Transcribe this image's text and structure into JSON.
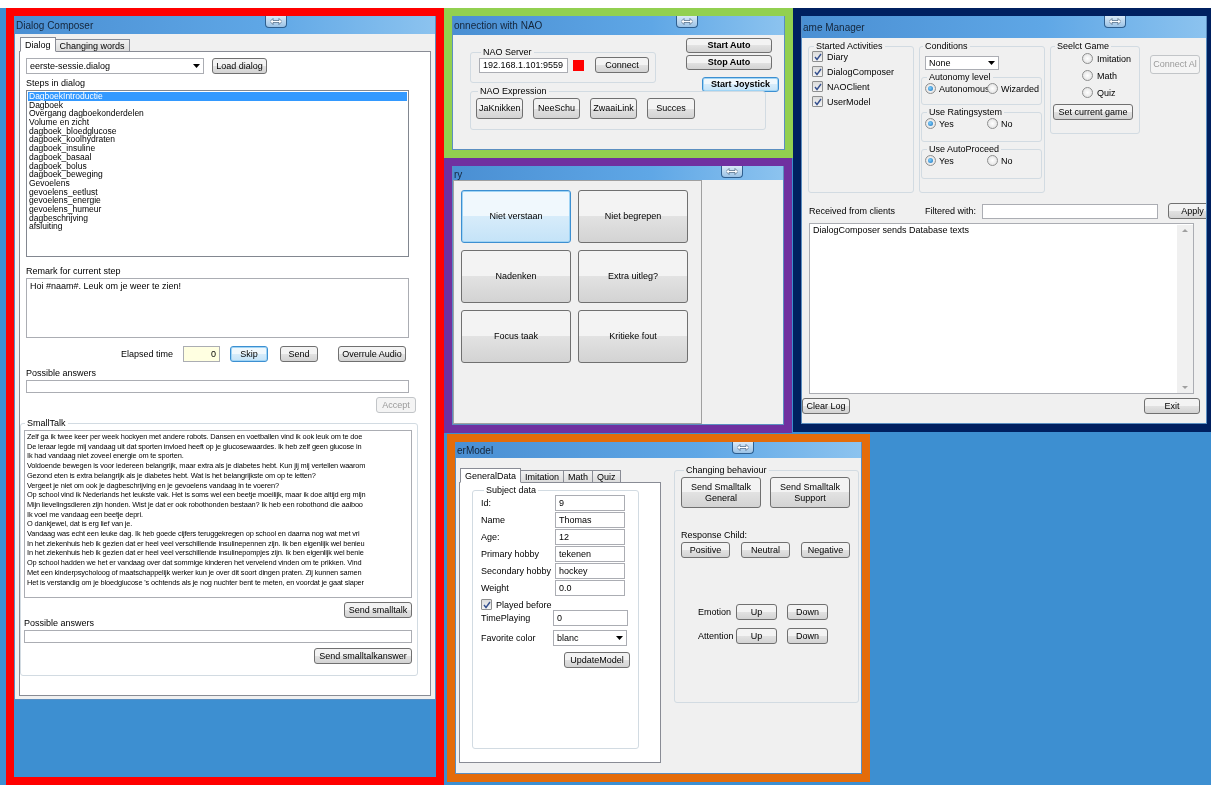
{
  "dialog_composer": {
    "title": "Dialog Composer",
    "tabs": [
      {
        "label": "Dialog",
        "selected": true
      },
      {
        "label": "Changing words",
        "selected": false
      }
    ],
    "dialog_file": "eerste-sessie.dialog",
    "load_button": "Load dialog",
    "steps_label": "Steps in dialog",
    "steps": [
      {
        "label": "DagboekIntroductie",
        "selected": true
      },
      {
        "label": "Dagboek",
        "selected": false
      },
      {
        "label": "Overgang dagboekonderdelen",
        "selected": false
      },
      {
        "label": "Volume en zicht",
        "selected": false
      },
      {
        "label": "dagboek_bloedglucose",
        "selected": false
      },
      {
        "label": "dagboek_koolhydraten",
        "selected": false
      },
      {
        "label": "dagboek_insuline",
        "selected": false
      },
      {
        "label": "dagboek_basaal",
        "selected": false
      },
      {
        "label": "dagboek_bolus",
        "selected": false
      },
      {
        "label": "dagboek_beweging",
        "selected": false
      },
      {
        "label": "Gevoelens",
        "selected": false
      },
      {
        "label": "gevoelens_eetlust",
        "selected": false
      },
      {
        "label": "gevoelens_energie",
        "selected": false
      },
      {
        "label": "gevoelens_humeur",
        "selected": false
      },
      {
        "label": "dagbeschrijving",
        "selected": false
      },
      {
        "label": "afsluiting",
        "selected": false
      }
    ],
    "remark_label": "Remark for current step",
    "remark": "Hoi #naam#. Leuk om je weer te zien!",
    "elapsed_label": "Elapsed time",
    "elapsed_value": "0",
    "controls": [
      {
        "label": "Skip",
        "focused": true
      },
      {
        "label": "Send",
        "focused": false
      },
      {
        "label": "Overrule Audio",
        "focused": false
      }
    ],
    "answers_label": "Possible answers",
    "accept": {
      "label": "Accept",
      "disabled": true
    },
    "smalltalk": {
      "title": "SmallTalk",
      "lines": [
        "Zelf ga ik twee keer per week hockyen met andere robots. Dansen en voetballen vind ik ook leuk om te doe",
        "De leraar legde mij vandaag uit dat sporten invloed heeft op je glucosewaardes. Ik heb zelf geen glucose in",
        "Ik had vandaag niet zoveel energie om te sporten.",
        "Voldoende bewegen is voor iedereen belangrijk, maar extra als je diabetes hebt. Kun jij mij vertellen waarom",
        "Gezond eten is extra belangrijk als je diabetes hebt. Wat is het belangrijkste om op te letten?",
        "Vergeet je niet om ook je dagbeschrijving en je gevoelens vandaag in te voeren?",
        "Op school vind ik Nederlands het leukste vak. Het is soms wel een beetje moeilijk, maar ik doe altijd erg mijn",
        "Mijn lievelingsdieren zijn honden. Wist je dat er ook robothonden bestaan? Ik heb een robothond die aaiboo",
        "Ik voel me vandaag een beetje depri.",
        "O dankjewel, dat is erg lief van je.",
        "Vandaag was echt een leuke dag. Ik heb goede cijfers teruggekregen op school en daarna nog wat met vri",
        "In het ziekenhuis heb ik gezien dat er heel veel verschillende insulinepennen zijn. Ik ben eigenlijk wel benieu",
        "In het ziekenhuis heb ik gezien dat er heel veel verschillende insulinepompjes zijn. Ik ben eigenlijk wel benie",
        "Op school hadden we het er vandaag over dat sommige kinderen het vervelend vinden om te prikken. Vind",
        "Met een kinderpsycholoog of maatschappelijk werker kun je over dit soort dingen praten. Zij kunnen samen",
        "Het is verstandig om je bloedglucose 's ochtends als je nog nuchter bent te meten, en voordat je gaat slaper"
      ],
      "send_button": "Send smalltalk",
      "answers_label": "Possible answers",
      "answer_button": "Send smalltalkanswer"
    }
  },
  "nao": {
    "title": "onnection with NAO",
    "server_group": "NAO Server",
    "server": "192.168.1.101:9559",
    "connected": false,
    "connect_button": "Connect",
    "auto_buttons": [
      {
        "label": "Start Auto",
        "focused": false
      },
      {
        "label": "Stop Auto",
        "focused": false
      },
      {
        "label": "Start Joystick",
        "focused": true
      }
    ],
    "expression_group": "NAO Expression",
    "expressions": [
      "JaKnikken",
      "NeeSchu",
      "ZwaaiLink",
      "Succes"
    ]
  },
  "diary": {
    "title": "ry",
    "buttons": [
      {
        "label": "Niet verstaan",
        "focused": true
      },
      {
        "label": "Niet begrepen",
        "focused": false
      },
      {
        "label": "Nadenken",
        "focused": false
      },
      {
        "label": "Extra uitleg?",
        "focused": false
      },
      {
        "label": "Focus taak",
        "focused": false
      },
      {
        "label": "Kritieke fout",
        "focused": false
      }
    ]
  },
  "game_manager": {
    "title": "ame Manager",
    "activities_group": "Started Activities",
    "activities": [
      {
        "label": "Diary",
        "checked": true
      },
      {
        "label": "DialogComposer",
        "checked": true
      },
      {
        "label": "NAOClient",
        "checked": true
      },
      {
        "label": "UserModel",
        "checked": true
      }
    ],
    "conditions_group": "Conditions",
    "condition": "None",
    "radio_groups": [
      {
        "title": "Autonomy level",
        "options": [
          {
            "label": "Autonomous",
            "selected": true
          },
          {
            "label": "Wizarded",
            "selected": false
          }
        ]
      },
      {
        "title": "Use Ratingsystem",
        "options": [
          {
            "label": "Yes",
            "selected": true
          },
          {
            "label": "No",
            "selected": false
          }
        ]
      },
      {
        "title": "Use AutoProceed",
        "options": [
          {
            "label": "Yes",
            "selected": true
          },
          {
            "label": "No",
            "selected": false
          }
        ]
      }
    ],
    "game_group": "Seelct Game",
    "games": [
      {
        "label": "Imitation",
        "selected": false
      },
      {
        "label": "Math",
        "selected": false
      },
      {
        "label": "Quiz",
        "selected": false
      }
    ],
    "set_game_button": "Set current game",
    "connect_button": {
      "label": "Connect Al",
      "disabled": true
    },
    "received_label": "Received from clients",
    "filter_label": "Filtered with:",
    "apply_button": "Apply",
    "log": [
      "DialogComposer sends Database texts"
    ],
    "clear_button": "Clear Log",
    "exit_button": "Exit"
  },
  "user_model": {
    "title": "erModel",
    "tabs": [
      {
        "label": "GeneralData",
        "selected": true
      },
      {
        "label": "Imitation",
        "selected": false
      },
      {
        "label": "Math",
        "selected": false
      },
      {
        "label": "Quiz",
        "selected": false
      }
    ],
    "subject_group": "Subject data",
    "fields": [
      {
        "label": "Id:",
        "value": "9"
      },
      {
        "label": "Name",
        "value": "Thomas"
      },
      {
        "label": "Age:",
        "value": "12"
      },
      {
        "label": "Primary hobby",
        "value": "tekenen"
      },
      {
        "label": "Secondary hobby",
        "value": "hockey"
      },
      {
        "label": "Weight",
        "value": "0.0"
      }
    ],
    "played_before": {
      "label": "Played before",
      "checked": true
    },
    "time_playing": {
      "label": "TimePlaying",
      "value": "0"
    },
    "favorite_color": {
      "label": "Favorite color",
      "value": "blanc"
    },
    "update_button": "UpdateModel",
    "behaviour_group": "Changing behaviour",
    "smalltalk_buttons": [
      "Send Smalltalk General",
      "Send Smalltalk Support"
    ],
    "response_label": "Response Child:",
    "responses": [
      "Positive",
      "Neutral",
      "Negative"
    ],
    "adjusters": [
      {
        "label": "Emotion",
        "up": "Up",
        "down": "Down"
      },
      {
        "label": "Attention",
        "up": "Up",
        "down": "Down"
      }
    ]
  }
}
